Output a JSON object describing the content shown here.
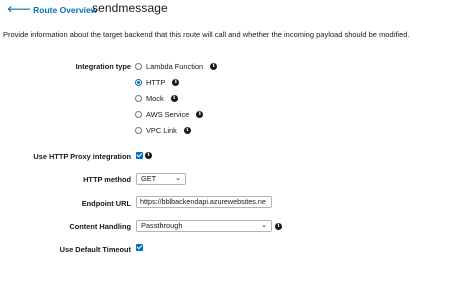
{
  "header": {
    "back_label": "Route Overview",
    "title": "sendmessage"
  },
  "description": "Provide information about the target backend that this route will call and whether the incoming payload should be modified.",
  "integration_type": {
    "label": "Integration type",
    "options": [
      {
        "label": "Lambda Function",
        "selected": false
      },
      {
        "label": "HTTP",
        "selected": true
      },
      {
        "label": "Mock",
        "selected": false
      },
      {
        "label": "AWS Service",
        "selected": false
      },
      {
        "label": "VPC Link",
        "selected": false
      }
    ]
  },
  "http_proxy": {
    "label": "Use HTTP Proxy integration",
    "checked": true
  },
  "http_method": {
    "label": "HTTP method",
    "value": "GET"
  },
  "endpoint_url": {
    "label": "Endpoint URL",
    "value": "https://bblbackendapi.azurewebsites.ne"
  },
  "content_handling": {
    "label": "Content Handling",
    "value": "Passthrough"
  },
  "default_timeout": {
    "label": "Use Default Timeout",
    "checked": true
  },
  "colors": {
    "link": "#0073bb",
    "accent": "#0073bb",
    "text": "#16191f",
    "border": "#aab7b8"
  },
  "icons": {
    "back": "left-arrow-icon",
    "info": "info-icon",
    "dropdown": "chevron-down-icon"
  }
}
